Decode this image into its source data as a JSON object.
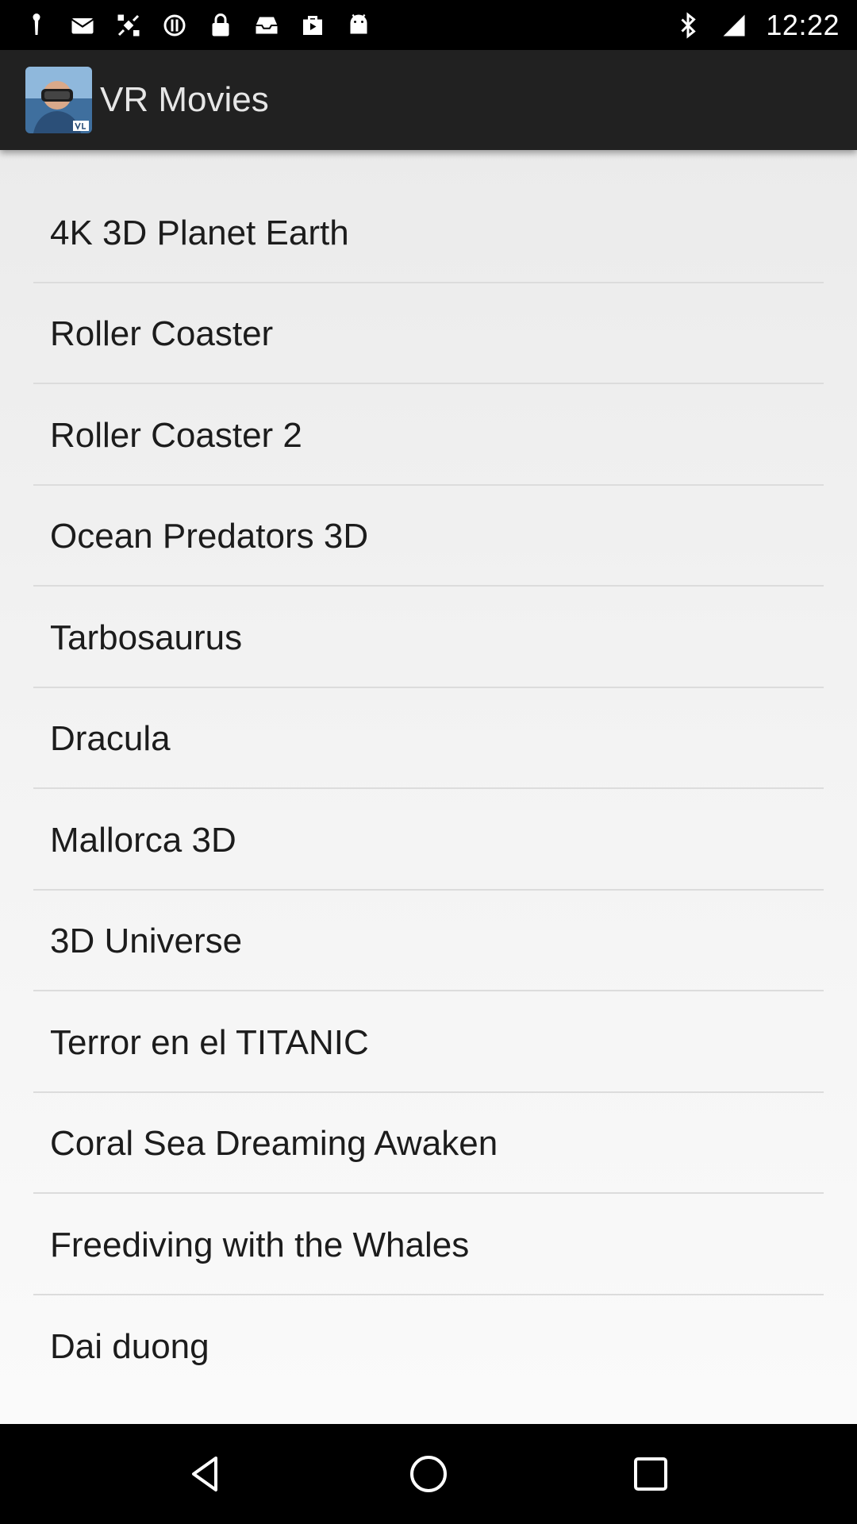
{
  "status_bar": {
    "time": "12:22",
    "left_icons": [
      "notification-icon",
      "mail-icon",
      "fake-gps-icon",
      "sync-icon",
      "lock-icon",
      "inbox-icon",
      "play-store-icon",
      "android-icon"
    ],
    "right_icons": [
      "bluetooth-icon",
      "signal-icon"
    ]
  },
  "app_bar": {
    "title": "VR Movies",
    "logo_icon": "vr-headset-logo"
  },
  "movies": [
    {
      "title": "4K 3D Planet Earth"
    },
    {
      "title": "Roller Coaster"
    },
    {
      "title": "Roller Coaster 2"
    },
    {
      "title": "Ocean Predators 3D"
    },
    {
      "title": "Tarbosaurus"
    },
    {
      "title": "Dracula"
    },
    {
      "title": "Mallorca 3D"
    },
    {
      "title": "3D Universe"
    },
    {
      "title": "Terror en el TITANIC"
    },
    {
      "title": "Coral Sea Dreaming Awaken"
    },
    {
      "title": "Freediving with the Whales"
    },
    {
      "title": "Dai duong"
    }
  ],
  "nav_bar": {
    "buttons": [
      "back-icon",
      "home-icon",
      "recents-icon"
    ]
  },
  "colors": {
    "app_bar": "#212121",
    "status_bar": "#000000",
    "list_text": "#1c1c1c",
    "divider": "#dcdcdc"
  }
}
